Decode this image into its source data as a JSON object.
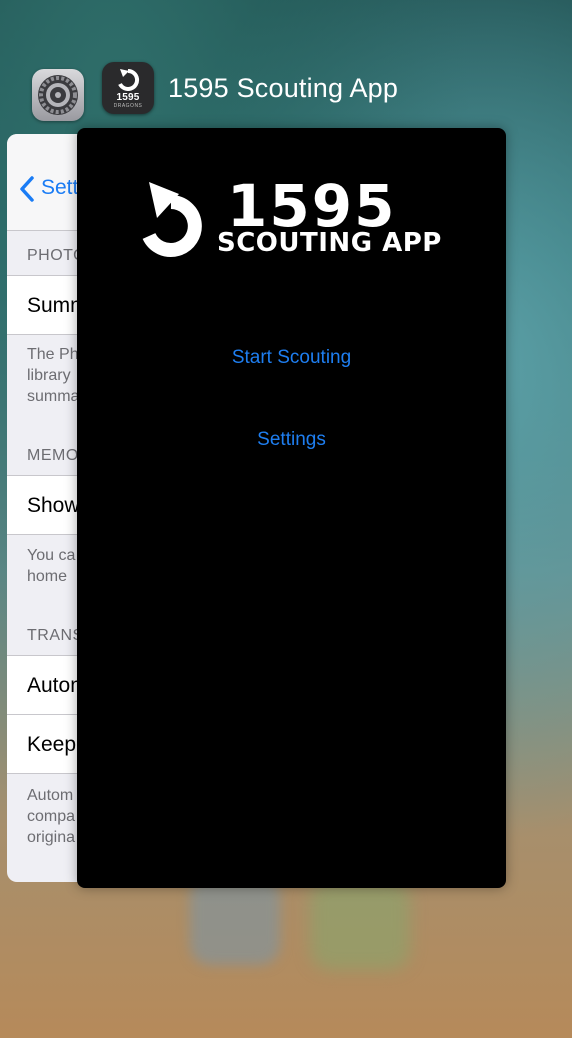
{
  "switcher": {
    "app_title": "1595 Scouting App",
    "icon_text": "1595",
    "icon_subtext": "DRAGONS"
  },
  "settings_card": {
    "back_label": "Sett",
    "sections": [
      {
        "header": "PHOTO",
        "cell": "Summ",
        "footer": [
          "The Ph",
          "library",
          "summa"
        ]
      },
      {
        "header": "MEMO",
        "cell": "Show",
        "footer": [
          "You ca",
          "home"
        ]
      },
      {
        "header": "TRANS",
        "cells": [
          "Autom",
          "Keep"
        ],
        "footer": [
          "Autom",
          "compa",
          "origina"
        ]
      }
    ]
  },
  "app_card": {
    "logo_number": "1595",
    "logo_subtitle": "SCOUTING APP",
    "start_scouting": "Start Scouting",
    "settings": "Settings"
  },
  "colors": {
    "accent": "#1e7ef0",
    "card_bg": "#000000",
    "ios_link": "#1a7cf5"
  }
}
